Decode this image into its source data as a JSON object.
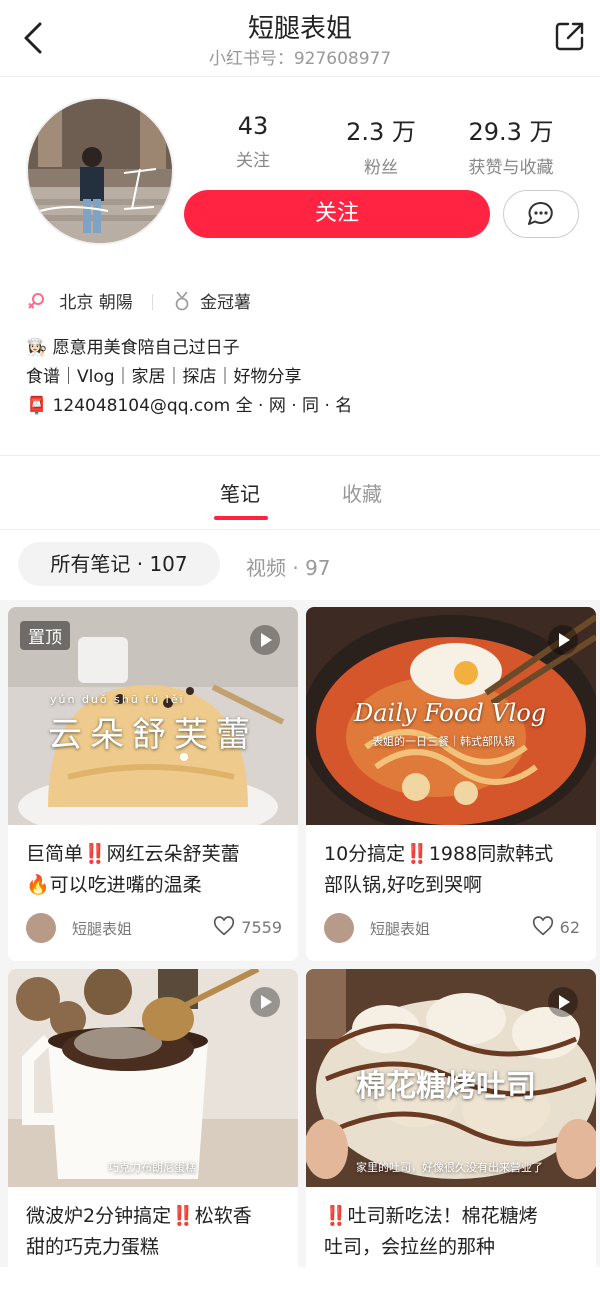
{
  "header": {
    "title": "短腿表姐",
    "subtitle": "小红书号：927608977"
  },
  "profile": {
    "stats": [
      {
        "num": "43",
        "label": "关注"
      },
      {
        "num": "2.3 万",
        "label": "粉丝"
      },
      {
        "num": "29.3 万",
        "label": "获赞与收藏"
      }
    ],
    "follow_label": "关注",
    "location": "北京 朝陽",
    "badge": "金冠薯",
    "bio": [
      "👩🏻‍🍳 愿意用美食陪自己过日子",
      "食谱｜Vlog｜家居｜探店｜好物分享",
      "📮 124048104@qq.com 全 · 网 · 同 · 名"
    ]
  },
  "tabs": {
    "notes": "笔记",
    "favorites": "收藏"
  },
  "filters": {
    "all": "所有笔记 · 107",
    "video": "视频 · 97"
  },
  "cards": [
    {
      "pin": "置顶",
      "overlay_pinyin": "yún  duǒ  shū  fú  lěi",
      "overlay_title": "云朵舒芙蕾",
      "caption_1": "巨简单‼️网红云朵舒芙蕾",
      "caption_2": "🔥可以吃进嘴的温柔",
      "author": "短腿表姐",
      "likes": "7559"
    },
    {
      "overlay_title": "Daily Food Vlog",
      "overlay_sub": "表姐的一日三餐｜韩式部队锅",
      "caption_1": "10分搞定‼️1988同款韩式",
      "caption_2": "部队锅,好吃到哭啊",
      "author": "短腿表姐",
      "likes": "62"
    },
    {
      "overlay_sub": "巧克力布朗尼蛋糕",
      "caption_1": "微波炉2分钟搞定‼️松软香",
      "caption_2": "甜的巧克力蛋糕"
    },
    {
      "overlay_title": "棉花糖烤吐司",
      "overlay_sub": "家里的吐司，好像很久没有出来营业了",
      "caption_1": "‼️吐司新吃法！棉花糖烤",
      "caption_2": "吐司，会拉丝的那种"
    }
  ],
  "colors": {
    "accent": "#ff2442",
    "muted": "#999999"
  }
}
